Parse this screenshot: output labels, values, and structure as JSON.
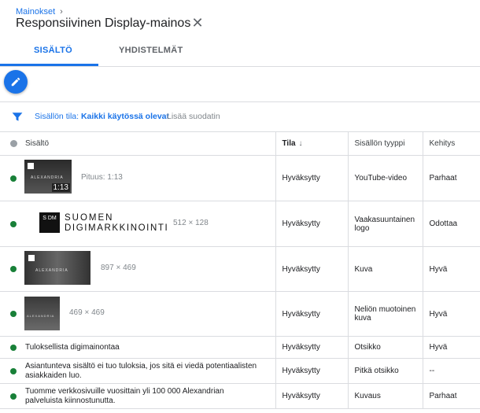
{
  "header": {
    "breadcrumb": "Mainokset",
    "breadcrumb_sep": "›",
    "title": "Responsiivinen Display-mainos",
    "close_glyph": "✕"
  },
  "tabs": [
    {
      "label": "SISÄLTÖ",
      "active": true
    },
    {
      "label": "YHDISTELMÄT",
      "active": false
    }
  ],
  "filter": {
    "label": "Sisällön tila:",
    "value": "Kaikki käytössä olevat",
    "add": "Lisää suodatin"
  },
  "table": {
    "headers": [
      "Sisältö",
      "Tila",
      "Sisällön tyyppi",
      "Kehitys"
    ],
    "sort_arrow": "↓",
    "rows": [
      {
        "content": "",
        "meta": "Pituus: 1:13",
        "duration": "1:13",
        "thumb_text": "ALEXANDRIA",
        "status": "Hyväksytty",
        "type": "YouTube-video",
        "perf": "Parhaat"
      },
      {
        "content": "",
        "meta": "512 × 128",
        "logo_line1": "SUOMEN",
        "logo_line2": "DIGIMARKKINOINTI",
        "logo_mark": "S DM",
        "status": "Hyväksytty",
        "type": "Vaakasuuntainen logo",
        "perf": "Odottaa"
      },
      {
        "content": "",
        "meta": "897 × 469",
        "thumb_text": "ALEXANDRIA",
        "status": "Hyväksytty",
        "type": "Kuva",
        "perf": "Hyvä"
      },
      {
        "content": "",
        "meta": "469 × 469",
        "thumb_text": "ALEXANDRIA",
        "status": "Hyväksytty",
        "type": "Neliön muotoinen kuva",
        "perf": "Hyvä"
      },
      {
        "content": "Tuloksellista digimainontaa",
        "status": "Hyväksytty",
        "type": "Otsikko",
        "perf": "Hyvä"
      },
      {
        "content": "Asiantunteva sisältö ei tuo tuloksia, jos sitä ei viedä potentiaalisten asiakkaiden luo.",
        "status": "Hyväksytty",
        "type": "Pitkä otsikko",
        "perf": "--"
      },
      {
        "content": "Tuomme verkkosivuille vuosittain yli 100 000 Alexandrian palveluista kiinnostunutta.",
        "status": "Hyväksytty",
        "type": "Kuvaus",
        "perf": "Parhaat"
      }
    ]
  },
  "colors": {
    "accent": "#1a73e8",
    "status_green": "#188038"
  },
  "icons": {
    "edit": "pencil-icon",
    "filter": "filter-funnel-icon",
    "close": "close-icon"
  }
}
